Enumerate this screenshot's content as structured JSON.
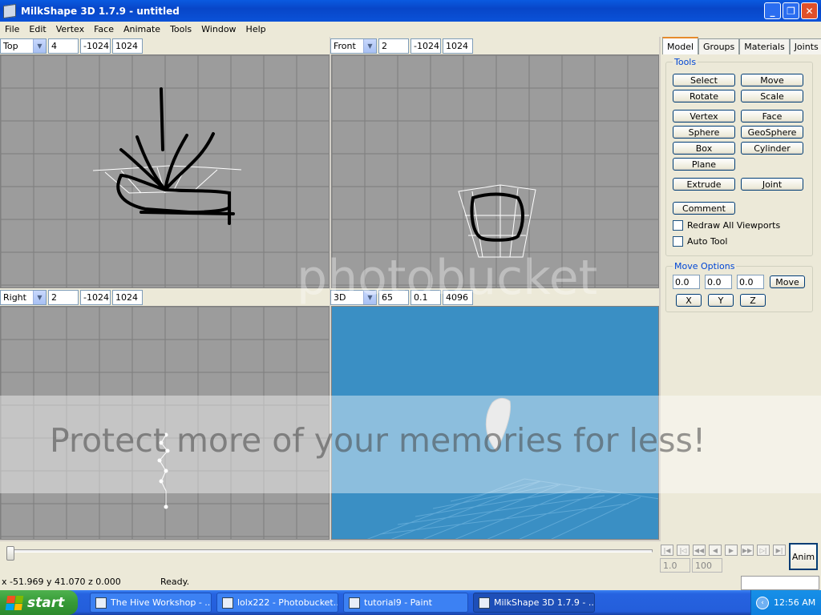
{
  "window": {
    "title": "MilkShape 3D 1.7.9 - untitled"
  },
  "menu": [
    "File",
    "Edit",
    "Vertex",
    "Face",
    "Animate",
    "Tools",
    "Window",
    "Help"
  ],
  "viewports": {
    "top_left": {
      "view": "Top",
      "v1": "4",
      "v2": "-1024",
      "v3": "1024"
    },
    "top_right": {
      "view": "Front",
      "v1": "2",
      "v2": "-1024",
      "v3": "1024"
    },
    "bottom_left": {
      "view": "Right",
      "v1": "2",
      "v2": "-1024",
      "v3": "1024"
    },
    "bottom_right": {
      "view": "3D",
      "v1": "65",
      "v2": "0.1",
      "v3": "4096"
    }
  },
  "colors": {
    "grid_bg": "#9c9c9c",
    "grid_line": "#7d7d7d",
    "view3d_bg": "#3a8fc4",
    "accent": "#0a52d8"
  },
  "panel": {
    "tabs": [
      "Model",
      "Groups",
      "Materials",
      "Joints"
    ],
    "tools_title": "Tools",
    "buttons": {
      "select": "Select",
      "move": "Move",
      "rotate": "Rotate",
      "scale": "Scale",
      "vertex": "Vertex",
      "face": "Face",
      "sphere": "Sphere",
      "geosphere": "GeoSphere",
      "box": "Box",
      "cylinder": "Cylinder",
      "plane": "Plane",
      "extrude": "Extrude",
      "joint": "Joint",
      "comment": "Comment"
    },
    "checkboxes": {
      "redraw": "Redraw All Viewports",
      "auto_tool": "Auto Tool"
    },
    "move_options": {
      "title": "Move Options",
      "x": "0.0",
      "y": "0.0",
      "z": "0.0",
      "move_btn": "Move",
      "x_btn": "X",
      "y_btn": "Y",
      "z_btn": "Z"
    }
  },
  "timeline": {
    "start": "1.0",
    "end": "100",
    "anim_btn": "Anim"
  },
  "status": {
    "coords": "x -51.969 y 41.070 z 0.000",
    "message": "Ready."
  },
  "taskbar": {
    "start": "start",
    "tasks": [
      "The Hive Workshop - ...",
      "lolx222 - Photobucket...",
      "tutorial9 - Paint",
      "MilkShape 3D 1.7.9 - ..."
    ],
    "clock": "12:56 AM"
  },
  "watermark": {
    "brand": "photobucket",
    "message": "Protect more of your memories for less!"
  }
}
